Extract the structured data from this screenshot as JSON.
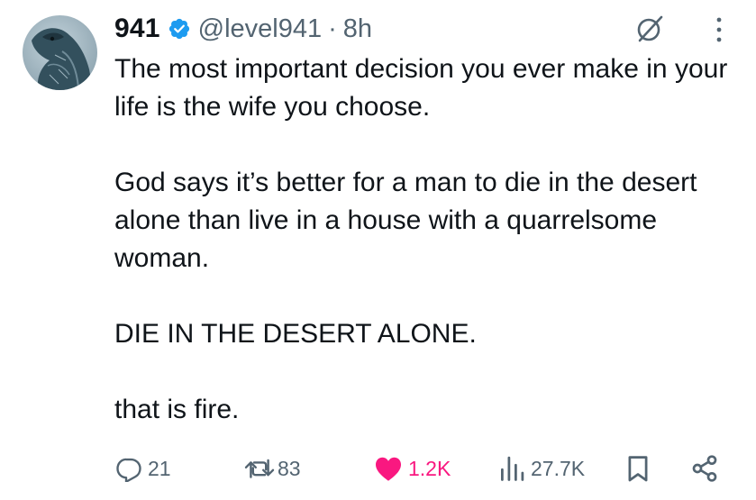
{
  "author": {
    "display_name": "941",
    "handle": "@level941",
    "separator": "·",
    "time": "8h",
    "verified": true
  },
  "tweet": {
    "paragraphs": [
      "The most important decision you ever make in your life is the wife you choose.",
      "God says it’s better for a man to die in the desert alone than live in a house with a quarrelsome woman.",
      "DIE IN THE DESERT ALONE.",
      "that is fire."
    ]
  },
  "actions": {
    "replies": "21",
    "reposts": "83",
    "likes": "1.2K",
    "views": "27.7K"
  },
  "icons": {
    "verified": "verified-badge-icon",
    "grok": "grok-icon",
    "more": "more-vertical-icon",
    "reply": "reply-icon",
    "repost": "repost-icon",
    "like": "heart-icon",
    "views": "views-icon",
    "bookmark": "bookmark-icon",
    "share": "share-icon"
  },
  "colors": {
    "accent": "#1d9bf0",
    "like": "#f91880",
    "secondary_text": "#536471",
    "text": "#0f1419"
  }
}
